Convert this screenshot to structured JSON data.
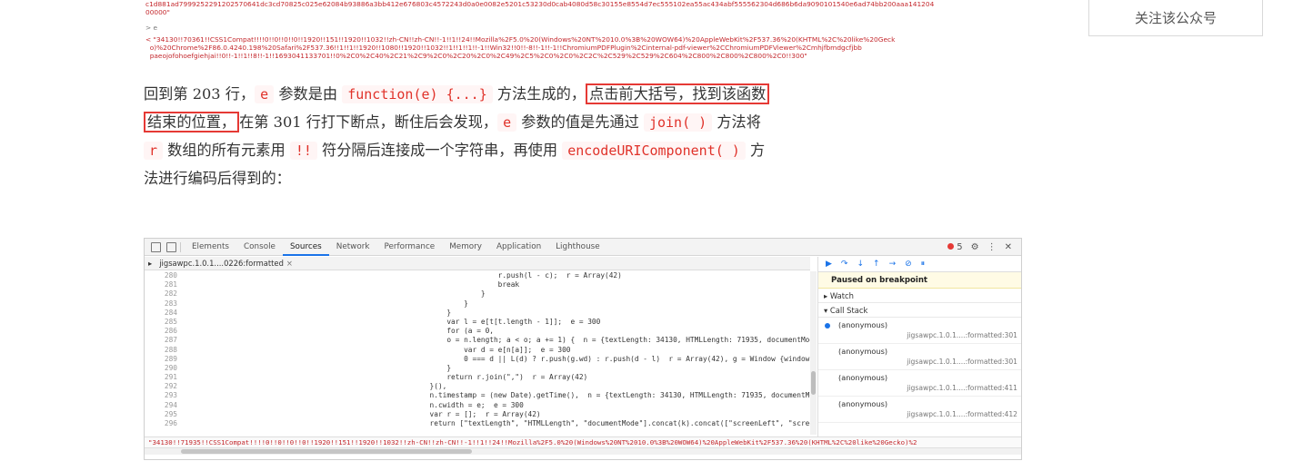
{
  "top_console": {
    "hash_line": "c1d881ad7999252291202570641dc3cd70825c025e62084b93886a3bb412e676803c4572243d0a0e0082e5201c53230d0cab4080d58c30155e8554d7ec555102ea55ac434abf555562304d686b6da9090101540e6ad74bb200aaa141204",
    "hash_line_2": "00000\"",
    "prompt": "> e",
    "result_1": "< \"34130!!70361!!CSS1Compat!!!!0!!0!!0!!0!!1920!!151!!1920!!1032!!zh-CN!!zh-CN!!-1!!1!!24!!Mozilla%2F5.0%20(Windows%20NT%2010.0%3B%20WOW64)%20AppleWebKit%2F537.36%20(KHTML%2C%20like%20Geck",
    "result_2": "  o)%20Chrome%2F86.0.4240.198%20Safari%2F537.36!!1!!1!!1920!!1080!!1920!!1032!!1!!1!!1!!-1!!Win32!!0!!-8!!-1!!-1!!ChromiumPDFPlugin%2Cinternal-pdf-viewer%2CChromiumPDFViewer%2Cmhjfbmdgcfjbb",
    "result_3": "  paeojofohoefgiehjai!!0!!-1!!1!!8!!-1!!1693041133701!!0%2C0%2C40%2C21%2C9%2C0%2C20%2C0%2C49%2C5%2C0%2C0%2C2C%2C529%2C529%2C604%2C800%2C800%2C800%2C0!!300\""
  },
  "follow_button": "关注该公众号",
  "article": {
    "l1_a": "回到第 203 行，",
    "l1_code1": "e",
    "l1_b": " 参数是由 ",
    "l1_code2": "function(e) {...}",
    "l1_c": " 方法生成的，",
    "l1_box": "点击前大括号，找到该函数",
    "l2_box": "结束的位置，",
    "l2_a": "在第 301 行打下断点，断住后会发现，",
    "l2_code1": "e",
    "l2_b": " 参数的值是先通过 ",
    "l2_code2": "join( )",
    "l2_c": " 方法将",
    "l3_code1": "r",
    "l3_a": " 数组的所有元素用 ",
    "l3_code2": "!!",
    "l3_b": " 符分隔后连接成一个字符串，再使用 ",
    "l3_code3": "encodeURIComponent( )",
    "l3_c": " 方",
    "l4": "法进行编码后得到的："
  },
  "devtools": {
    "tabs": [
      "Elements",
      "Console",
      "Sources",
      "Network",
      "Performance",
      "Memory",
      "Application",
      "Lighthouse"
    ],
    "active_tab": "Sources",
    "error_count": "5",
    "file_tab": "jigsawpc.1.0.1....0226:formatted",
    "file_close": "×",
    "code_rows": [
      {
        "ln": "280",
        "code": "                        r.push(l - c);  r = Array(42)"
      },
      {
        "ln": "281",
        "code": "                        break"
      },
      {
        "ln": "282",
        "code": "                    }"
      },
      {
        "ln": "283",
        "code": "                }"
      },
      {
        "ln": "284",
        "code": "            }"
      },
      {
        "ln": "285",
        "code": "            var l = e[t[t.length - 1]];  e = 300"
      },
      {
        "ln": "286",
        "code": "            for (a = 0,"
      },
      {
        "ln": "287",
        "code": "            o = n.length; a < o; a += 1) {  n = {textLength: 34130, HTMLLength: 71935, documentMode: \"CSS1Com"
      },
      {
        "ln": "288",
        "code": "                var d = e[n[a]];  e = 300"
      },
      {
        "ln": "289",
        "code": "                0 === d || L(d) ? r.push(g.wd) : r.push(d - l)  r = Array(42), g = Window {window: Window, se"
      },
      {
        "ln": "290",
        "code": "            }"
      },
      {
        "ln": "291",
        "code": "            return r.join(\",\")  r = Array(42)"
      },
      {
        "ln": "292",
        "code": "        }(),"
      },
      {
        "ln": "293",
        "code": "        n.timestamp = (new Date).getTime(),  n = {textLength: 34130, HTMLLength: 71935, documentMode: \"CSS1Co"
      },
      {
        "ln": "294",
        "code": "        n.cwidth = e;  e = 300"
      },
      {
        "ln": "295",
        "code": "        var r = [];  r = Array(42)"
      },
      {
        "ln": "296",
        "code": "        return [\"textLength\", \"HTMLLength\", \"documentMode\"].concat(k).concat([\"screenLeft\", \"screenTop\", \"scre"
      }
    ],
    "paused_label": "Paused on breakpoint",
    "watch_label": "▸ Watch",
    "callstack_label": "▾ Call Stack",
    "frames": [
      {
        "name": "(anonymous)",
        "loc": "jigsawpc.1.0.1....:formatted:301"
      },
      {
        "name": "(anonymous)",
        "loc": "jigsawpc.1.0.1....:formatted:301"
      },
      {
        "name": "(anonymous)",
        "loc": "jigsawpc.1.0.1....:formatted:411"
      },
      {
        "name": "(anonymous)",
        "loc": "jigsawpc.1.0.1....:formatted:412"
      }
    ],
    "bottom_value": "\"34130!!71935!!CSS1Compat!!!!0!!0!!0!!0!!1920!!151!!1920!!1032!!zh-CN!!zh-CN!!-1!!1!!24!!Mozilla%2F5.0%20(Windows%20NT%2010.0%3B%20WOW64)%20AppleWebKit%2F537.36%20(KHTML%2C%20like%20Gecko)%2"
  }
}
